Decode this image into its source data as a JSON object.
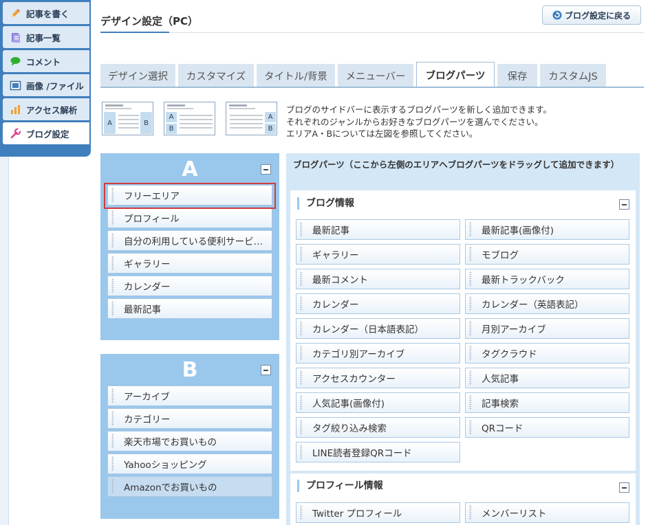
{
  "nav": {
    "items": [
      {
        "label": "記事を書く",
        "icon": "pencil-icon"
      },
      {
        "label": "記事一覧",
        "icon": "document-icon"
      },
      {
        "label": "コメント",
        "icon": "speech-bubble-icon"
      },
      {
        "label": "画像 /ファイル",
        "icon": "image-icon"
      },
      {
        "label": "アクセス解析",
        "icon": "bar-chart-icon"
      },
      {
        "label": "ブログ設定",
        "icon": "wrench-icon"
      }
    ],
    "active_index": 5
  },
  "header": {
    "title": "デザイン設定（PC）",
    "back_button": "ブログ設定に戻る"
  },
  "tabs": [
    {
      "label": "デザイン選択"
    },
    {
      "label": "カスタマイズ"
    },
    {
      "label": "タイトル/背景"
    },
    {
      "label": "メニューバー"
    },
    {
      "label": "ブログパーツ"
    },
    {
      "label": "保存"
    },
    {
      "label": "カスタムJS"
    }
  ],
  "active_tab": "ブログパーツ",
  "layout_diagrams": {
    "area_a": "A",
    "area_b": "B"
  },
  "info": {
    "line1": "ブログのサイドバーに表示するブログパーツを新しく追加できます。",
    "line2": "それぞれのジャンルからお好きなブログパーツを選んでください。",
    "line3": "エリアA・Bについては左図を参照してください。"
  },
  "area_a": {
    "label": "A",
    "items": [
      "フリーエリア",
      "プロフィール",
      "自分の利用している便利サービス...",
      "ギャラリー",
      "カレンダー",
      "最新記事"
    ]
  },
  "area_b": {
    "label": "B",
    "items": [
      "アーカイブ",
      "カテゴリー",
      "楽天市場でお買いもの",
      "Yahooショッピング",
      "Amazonでお買いもの"
    ]
  },
  "library": {
    "title": "ブログパーツ（ここから左側のエリアへブログパーツをドラッグして追加できます）",
    "groups": [
      {
        "title": "ブログ情報",
        "items": [
          "最新記事",
          "最新記事(画像付)",
          "ギャラリー",
          "モブログ",
          "最新コメント",
          "最新トラックバック",
          "カレンダー",
          "カレンダー（英語表記）",
          "カレンダー（日本語表記）",
          "月別アーカイブ",
          "カテゴリ別アーカイブ",
          "タグクラウド",
          "アクセスカウンター",
          "人気記事",
          "人気記事(画像付)",
          "記事検索",
          "タグ絞り込み検索",
          "QRコード",
          "LINE読者登録QRコード"
        ]
      },
      {
        "title": "プロフィール情報",
        "items": [
          "Twitter プロフィール",
          "メンバーリスト"
        ]
      }
    ]
  },
  "colors": {
    "nav_blue": "#3f7fbd",
    "area_blue": "#9ac7ec",
    "library_blue": "#d4e7f6",
    "highlight_red": "#d23a3a"
  }
}
